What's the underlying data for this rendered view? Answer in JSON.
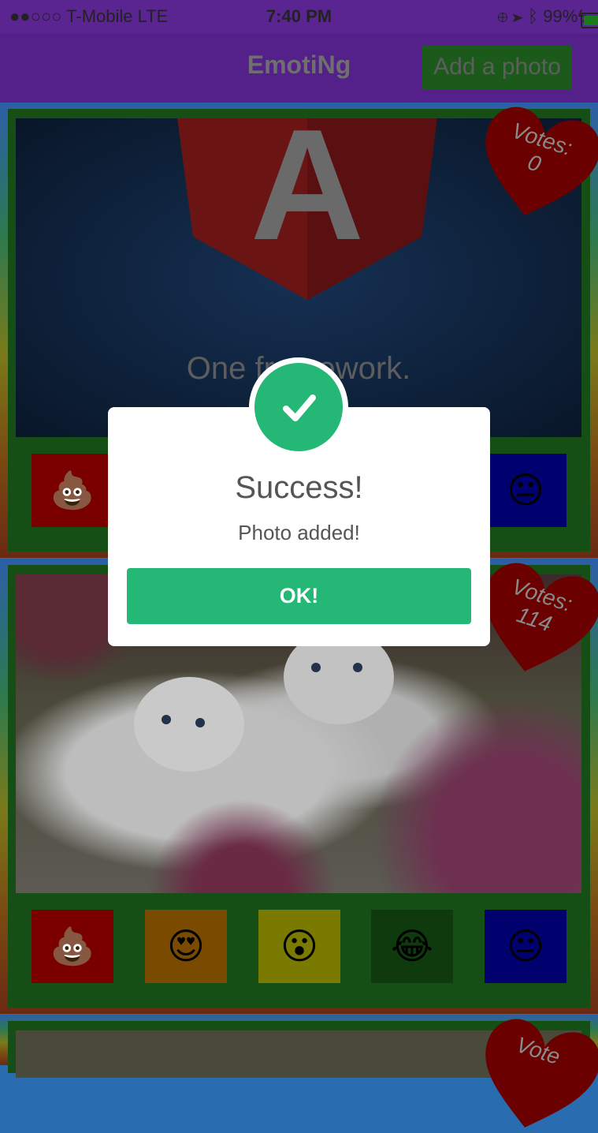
{
  "status_bar": {
    "carrier": "●●○○○ T-Mobile   LTE",
    "time": "7:40 PM",
    "battery": "99%"
  },
  "header": {
    "title": "EmotiNg",
    "add_button": "Add a photo"
  },
  "posts": [
    {
      "votes_label": "Votes:",
      "votes": "0",
      "image_text": "One framework.",
      "image_logo_letter": "A"
    },
    {
      "votes_label": "Votes:",
      "votes": "114"
    },
    {
      "votes_label": "Vote"
    }
  ],
  "reactions": [
    {
      "name": "poop",
      "glyph": "💩",
      "color": "#7a0000"
    },
    {
      "name": "heart-eyes",
      "glyph": "😍",
      "color": "#7a4a00"
    },
    {
      "name": "surprised",
      "glyph": "😮",
      "color": "#7a7a00"
    },
    {
      "name": "laughing",
      "glyph": "😂",
      "color": "#0e3a0e"
    },
    {
      "name": "neutral",
      "glyph": "😐",
      "color": "#00006e"
    }
  ],
  "modal": {
    "title": "Success!",
    "message": "Photo added!",
    "ok_button": "OK!",
    "accent": "#25b775"
  }
}
